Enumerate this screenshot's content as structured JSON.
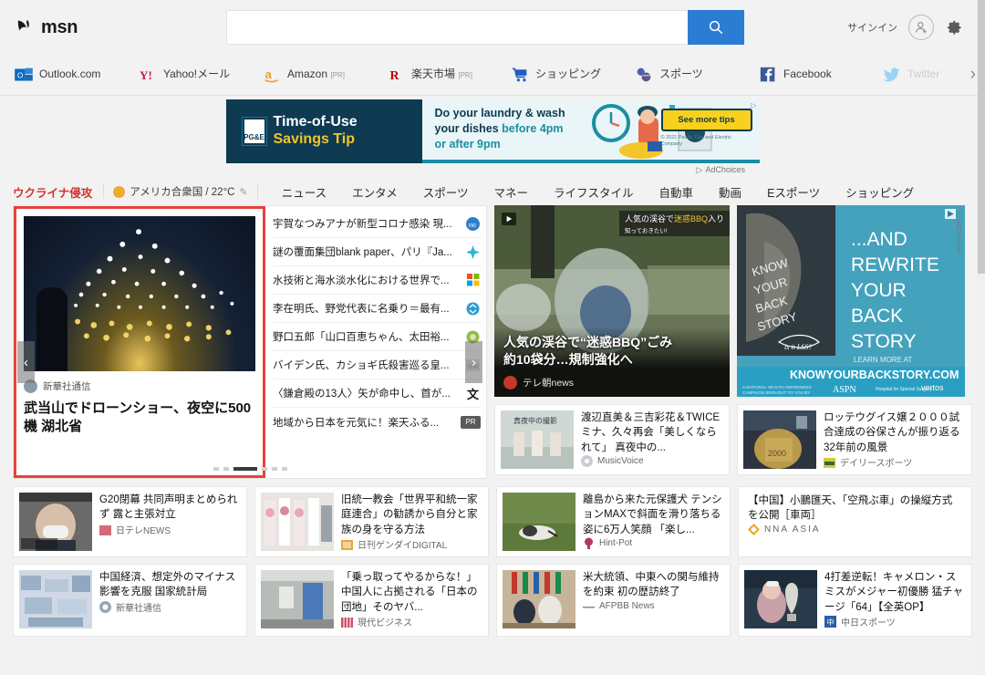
{
  "header": {
    "logo_text": "msn",
    "search_placeholder": "",
    "search_value": "",
    "search_icon": "search-icon",
    "signin_label": "サインイン",
    "settings_icon": "gear-icon"
  },
  "quicklinks": {
    "next_label": "›",
    "items": [
      {
        "label": "Outlook.com",
        "icon": "outlook-icon",
        "pr": "",
        "dim": false
      },
      {
        "label": "Yahoo!メール",
        "icon": "yahoo-icon",
        "pr": "",
        "dim": false
      },
      {
        "label": "Amazon",
        "icon": "amazon-icon",
        "pr": "[PR]",
        "dim": false
      },
      {
        "label": "楽天市場",
        "icon": "rakuten-icon",
        "pr": "[PR]",
        "dim": false
      },
      {
        "label": "ショッピング",
        "icon": "cart-icon",
        "pr": "",
        "dim": false
      },
      {
        "label": "スポーツ",
        "icon": "sports-icon",
        "pr": "",
        "dim": false
      },
      {
        "label": "Facebook",
        "icon": "facebook-icon",
        "pr": "",
        "dim": false
      },
      {
        "label": "Twitter",
        "icon": "twitter-icon",
        "pr": "",
        "dim": true
      }
    ]
  },
  "banner_ad": {
    "brand": "PG&E",
    "title_line1": "Time-of-Use",
    "title_line2": "Savings Tip",
    "copy_line1": "Do your laundry & wash",
    "copy_line2a": "your dishes ",
    "copy_line2b": "before 4pm",
    "copy_line3": "or after 9pm",
    "cta_label": "See more tips",
    "legal": "© 2021 Pacific Gas and Electric Company",
    "adchoices_label": "AdChoices"
  },
  "navtabs": {
    "hot_topic": "ウクライナ侵攻",
    "weather": "アメリカ合衆国 / 22°C",
    "weather_edit_icon": "pencil-icon",
    "items": [
      "ニュース",
      "エンタメ",
      "スポーツ",
      "マネー",
      "ライフスタイル",
      "自動車",
      "動画",
      "Eスポーツ",
      "ショッピング"
    ]
  },
  "featured": {
    "source": "新華社通信",
    "title": "武当山でドローンショー、夜空に500機 湖北省",
    "prev_arrow": "‹",
    "next_arrow": "›",
    "dots_total": 7,
    "dots_active": 2
  },
  "headline_list": [
    {
      "text": "宇賀なつみアナが新型コロナ感染 現...",
      "badge": "source-badge-blue"
    },
    {
      "text": "謎の覆面集団blank paper、パリ『Ja...",
      "badge": "source-badge-cyan"
    },
    {
      "text": "水技術と海水淡水化における世界で...",
      "badge": "microsoft-icon"
    },
    {
      "text": "李在明氏、野党代表に名乗り＝最有...",
      "badge": "source-badge-recycle"
    },
    {
      "text": "野口五郎「山口百恵ちゃん、太田裕...",
      "badge": "source-badge-green"
    },
    {
      "text": "バイデン氏、カショギ氏殺害巡る皇...",
      "badge": "source-badge-grey"
    },
    {
      "text": "〈鎌倉殿の13人〉矢が命中し、首が...",
      "badge": "bungei-icon"
    },
    {
      "text": "地域から日本を元気に！楽天ふる...",
      "badge": "PR"
    }
  ],
  "big_card": {
    "title_line1": "人気の渓谷で“迷惑BBQ”ごみ",
    "title_line2": "約10袋分…規制強化へ",
    "source": "テレ朝news",
    "play_icon": "play-icon",
    "overlay_chip_main": "人気の渓谷で",
    "overlay_chip_hl": "迷惑BBQ",
    "overlay_chip_tail": "入り",
    "overlay_chip_sub": "知っておきたい!"
  },
  "side_ad": {
    "line1": "...AND",
    "line2": "REWRITE",
    "line3": "YOUR",
    "line4": "BACK",
    "line5": "STORY",
    "img_text": "KNOW YOUR BACK STORY",
    "learn": "LEARN MORE AT",
    "url": "KNOWYOURBACKSTORY.COM",
    "fineprint": "A NATIONAL HEALTH AWARENESS CAMPAIGN BROUGHT TO YOU BY",
    "sponsors": [
      "ASPN",
      "Hospital for Special Surgery",
      "Vertos"
    ],
    "adchoices_label": "AdChoices"
  },
  "cards": [
    {
      "title": "渡辺直美＆三吉彩花＆TWICEミナ、久々再会「美しくなられて」 真夜中の...",
      "source": "MusicVoice",
      "source_icon": "musicvoice-icon",
      "thumb": "gradient-group-photo",
      "highlighted": false,
      "has_thumb": true
    },
    {
      "title": "ロッテウグイス嬢２０００試合達成の谷保さんが振り返る32年前の風景",
      "source": "デイリースポーツ",
      "source_icon": "daily-sports-icon",
      "thumb": "gradient-stadium",
      "highlighted": false,
      "has_thumb": true
    },
    {
      "title": "G20閉幕 共同声明まとめられず 露と主張対立",
      "source": "日テレNEWS",
      "source_icon": "ntv-icon",
      "thumb": "gradient-press",
      "highlighted": false,
      "has_thumb": true
    },
    {
      "title": "旧統一教会「世界平和統一家庭連合」の勧誘から自分と家族の身を守る方法",
      "source": "日刊ゲンダイDIGITAL",
      "source_icon": "gendai-icon",
      "thumb": "gradient-wedding",
      "highlighted": false,
      "has_thumb": true
    },
    {
      "title": "離島から来た元保護犬 テンションMAXで斜面を滑り落ちる姿に6万人笑顔 「楽し...",
      "source": "Hint-Pot",
      "source_icon": "hintpot-icon",
      "thumb": "gradient-dog",
      "highlighted": false,
      "has_thumb": true
    },
    {
      "title": "【中国】小鵬匯天、「空飛ぶ車」の操縦方式を公開［車両］",
      "source": "NNA ASIA",
      "source_icon": "nna-icon",
      "thumb": "",
      "highlighted": false,
      "has_thumb": false
    },
    {
      "title": "中国経済、想定外のマイナス影響を克服 国家統計局",
      "source": "新華社通信",
      "source_icon": "xinhua-icon",
      "thumb": "gradient-ice",
      "highlighted": true,
      "has_thumb": true
    },
    {
      "title": "「乗っ取ってやるからな！」中国人に占拠される「日本の団地」そのヤバ...",
      "source": "現代ビジネス",
      "source_icon": "gendai-biz-icon",
      "thumb": "gradient-corridor",
      "highlighted": false,
      "has_thumb": true
    },
    {
      "title": "米大統領、中東への関与維持を約束 初の歴訪終了",
      "source": "AFPBB News",
      "source_icon": "afpbb-icon",
      "thumb": "gradient-summit",
      "highlighted": false,
      "has_thumb": true
    },
    {
      "title": "4打差逆転！キャメロン・スミスがメジャー初優勝 猛チャージ「64」【全英OP】",
      "source": "中日スポーツ",
      "source_icon": "chunichi-icon",
      "thumb": "gradient-golf",
      "highlighted": false,
      "has_thumb": true
    }
  ],
  "colors": {
    "accent_red": "#e8413c",
    "search_blue": "#2b7cd3",
    "hot_topic_red": "#d0342c",
    "page_bg": "#f2f2f2"
  }
}
